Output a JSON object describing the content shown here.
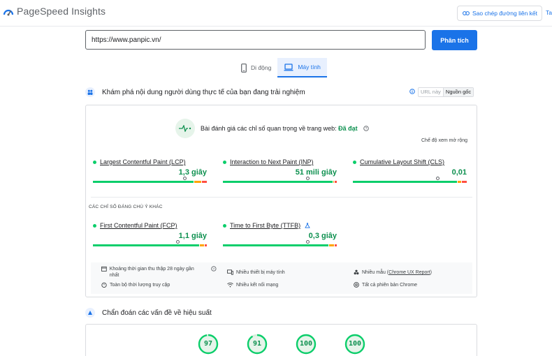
{
  "header": {
    "app_title": "PageSpeed Insights",
    "copy_link_label": "Sao chép đường liên kết",
    "truncated_label": "Ta"
  },
  "search": {
    "url_value": "https://www.panpic.vn/",
    "analyze_label": "Phân tích"
  },
  "tabs": [
    {
      "label": "Di động",
      "icon": "smartphone-icon",
      "active": false
    },
    {
      "label": "Máy tính",
      "icon": "laptop-icon",
      "active": true
    }
  ],
  "crux": {
    "title": "Khám phá nội dung người dùng thực tế của bạn đang trải nghiệm",
    "toggle_url": "URL này",
    "toggle_origin": "Nguồn gốc",
    "assessment_prefix": "Bài đánh giá các chỉ số quan trọng về trang web:",
    "assessment_result": "Đã đạt",
    "expand_label": "Chế độ xem mở rộng",
    "other_metrics_label": "CÁC CHỈ SỐ ĐÁNG CHÚ Ý KHÁC",
    "core_metrics": [
      {
        "name": "Largest Contentful Paint (LCP)",
        "value": "1,3 giây",
        "marker_pct": 0.81,
        "dist": [
          0.89,
          0.07,
          0.04
        ]
      },
      {
        "name": "Interaction to Next Paint (INP)",
        "value": "51 mili giây",
        "marker_pct": 0.75,
        "dist": [
          0.97,
          0.01,
          0.02
        ]
      },
      {
        "name": "Cumulative Layout Shift (CLS)",
        "value": "0,01",
        "marker_pct": 0.75,
        "dist": [
          0.92,
          0.04,
          0.04
        ]
      }
    ],
    "other_metrics": [
      {
        "name": "First Contentful Paint (FCP)",
        "value": "1,1 giây",
        "marker_pct": 0.75,
        "dist": [
          0.94,
          0.04,
          0.02
        ],
        "experimental": false
      },
      {
        "name": "Time to First Byte (TTFB)",
        "value": "0,3 giây",
        "marker_pct": 0.75,
        "dist": [
          0.93,
          0.05,
          0.02
        ],
        "experimental": true
      }
    ],
    "footer": {
      "period": "Khoảng thời gian thu thập 28 ngày gần nhất",
      "devices": "Nhiều thiết bị máy tính",
      "samples_prefix": "Nhiều mẫu (",
      "samples_link": "Chrome UX Report",
      "samples_suffix": ")",
      "duration": "Toàn bộ thời lượng truy cập",
      "network": "Nhiều kết nối mạng",
      "chrome": "Tất cả phiên bản Chrome"
    }
  },
  "diagnostics": {
    "title": "Chẩn đoán các vấn đề về hiệu suất",
    "scores": [
      97,
      91,
      100,
      100
    ]
  },
  "colors": {
    "accent": "#1a73e8",
    "good": "#0cce6b",
    "good_text": "#0d904f",
    "needs_improvement": "#ffa400",
    "poor": "#ff4e42"
  }
}
